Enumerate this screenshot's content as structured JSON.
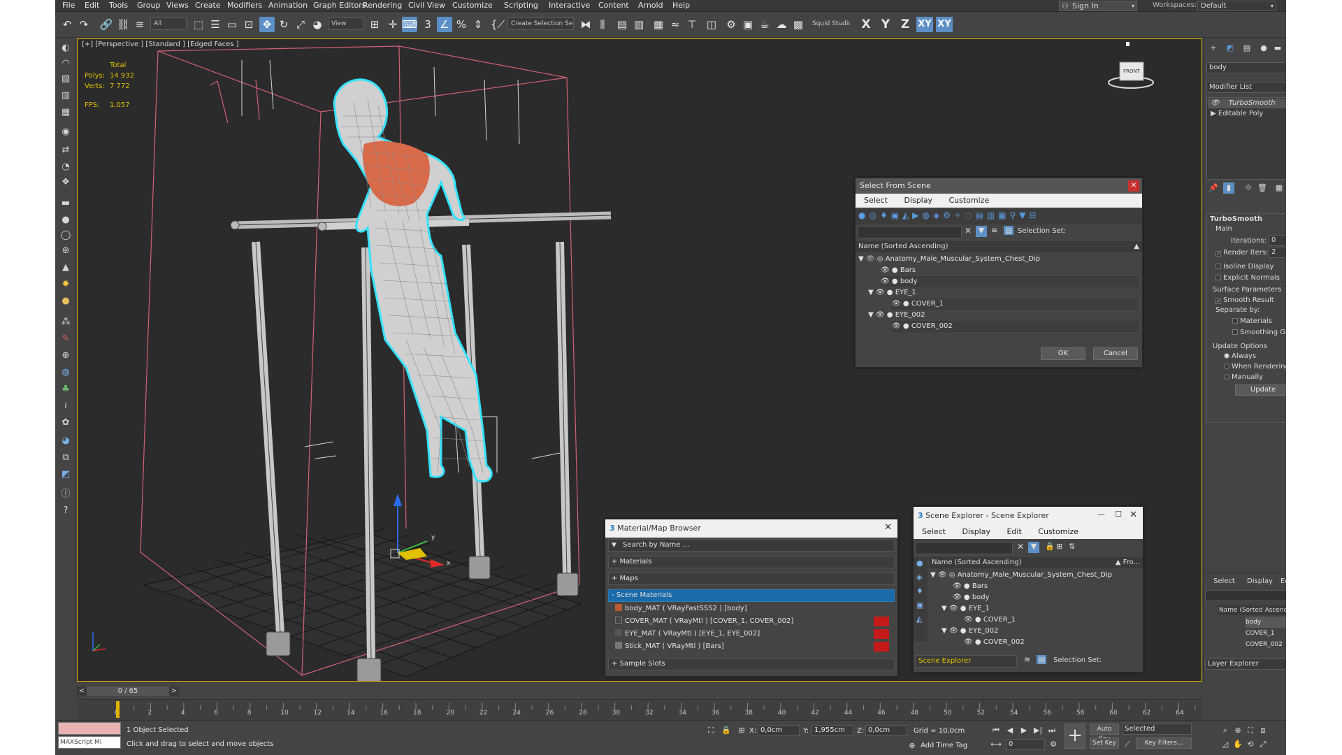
{
  "menubar": {
    "items": [
      "File",
      "Edit",
      "Tools",
      "Group",
      "Views",
      "Create",
      "Modifiers",
      "Animation",
      "Graph Editors",
      "Rendering",
      "Civil View",
      "Customize",
      "Scripting",
      "Interactive",
      "Content",
      "Arnold",
      "Help"
    ],
    "signin": "Sign In",
    "workspaces_label": "Workspaces:",
    "workspace_value": "Default"
  },
  "toolbar": {
    "filter_value": "All",
    "refcoord_value": "View",
    "selection_set_value": "Create Selection Se",
    "workspace_name": "Squid Studio v",
    "axis_x": "X",
    "axis_y": "Y",
    "axis_z": "Z",
    "axis_xy": "XY",
    "axis_xy2": "XY"
  },
  "viewport": {
    "label": "[+] [Perspective ] [Standard ] [Edged Faces ]",
    "stats_header": "Total",
    "polys_label": "Polys:",
    "polys_value": "14 932",
    "verts_label": "Verts:",
    "verts_value": "7 772",
    "fps_label": "FPS:",
    "fps_value": "1,057",
    "viewcube_label": "FRONT",
    "gizmo_y": "y",
    "gizmo_x": "x"
  },
  "select_from_scene": {
    "title": "Select From Scene",
    "menu": [
      "Select",
      "Display",
      "Customize"
    ],
    "selection_set_label": "Selection Set:",
    "column_header": "Name (Sorted Ascending)",
    "rows": [
      {
        "name": "Anatomy_Male_Muscular_System_Chest_Dip",
        "depth": 0,
        "expanded": true
      },
      {
        "name": "Bars",
        "depth": 1
      },
      {
        "name": "body",
        "depth": 1
      },
      {
        "name": "EYE_1",
        "depth": 1,
        "expanded": true
      },
      {
        "name": "COVER_1",
        "depth": 2
      },
      {
        "name": "EYE_002",
        "depth": 1,
        "expanded": true
      },
      {
        "name": "COVER_002",
        "depth": 2
      }
    ],
    "ok_label": "OK",
    "cancel_label": "Cancel"
  },
  "material_browser": {
    "title": "Material/Map Browser",
    "search_placeholder": "Search by Name ...",
    "sections": [
      "+ Materials",
      "+ Maps",
      "- Scene Materials"
    ],
    "materials": [
      "body_MAT ( VRayFastSSS2 ) [body]",
      "COVER_MAT ( VRayMtl ) [COVER_1, COVER_002]",
      "EYE_MAT ( VRayMtl ) [EYE_1, EYE_002]",
      "Stick_MAT ( VRayMtl ) [Bars]"
    ],
    "sample_slots": "+ Sample Slots"
  },
  "scene_explorer": {
    "title": "Scene Explorer - Scene Explorer",
    "menu": [
      "Select",
      "Display",
      "Edit",
      "Customize"
    ],
    "column_header": "Name (Sorted Ascending)",
    "column_header2": "▲ Fro...",
    "rows": [
      {
        "name": "Anatomy_Male_Muscular_System_Chest_Dip",
        "depth": 0
      },
      {
        "name": "Bars",
        "depth": 1
      },
      {
        "name": "body",
        "depth": 1
      },
      {
        "name": "EYE_1",
        "depth": 1
      },
      {
        "name": "COVER_1",
        "depth": 2
      },
      {
        "name": "EYE_002",
        "depth": 1
      },
      {
        "name": "COVER_002",
        "depth": 2
      }
    ],
    "footer_name": "Scene Explorer",
    "selection_set_label": "Selection Set:"
  },
  "command_panel": {
    "name_value": "body",
    "modifier_list": "Modifier List",
    "stack": [
      "TurboSmooth",
      "Editable Poly"
    ],
    "rollout_title": "TurboSmooth",
    "main_label": "Main",
    "iterations_label": "Iterations:",
    "iterations_value": "0",
    "render_iters_label": "Render Iters:",
    "render_iters_value": "2",
    "isoline": "Isoline Display",
    "explicit_normals": "Explicit Normals",
    "surface_params": "Surface Parameters",
    "smooth_result": "Smooth Result",
    "separate_by": "Separate by:",
    "materials": "Materials",
    "smoothing_groups": "Smoothing Groups",
    "update_options": "Update Options",
    "always": "Always",
    "when_rendering": "When Rendering",
    "manually": "Manually",
    "update_btn": "Update"
  },
  "layer_explorer": {
    "menu": [
      "Select",
      "Display",
      "Edit"
    ],
    "column_header": "Name (Sorted Ascending)",
    "rows": [
      "body",
      "COVER_1",
      "COVER_002"
    ],
    "footer": "Layer Explorer"
  },
  "timeline": {
    "frame_display": "0 / 65",
    "ticks": [
      "0",
      "2",
      "4",
      "6",
      "8",
      "10",
      "12",
      "14",
      "16",
      "18",
      "20",
      "22",
      "24",
      "26",
      "28",
      "30",
      "32",
      "34",
      "36",
      "38",
      "40",
      "42",
      "44",
      "46",
      "48",
      "50",
      "52",
      "54",
      "56",
      "58",
      "60",
      "62",
      "64"
    ],
    "current_frame": 0,
    "total_frames": 65
  },
  "statusbar": {
    "maxscript": "MAXScript Mi",
    "selected_text": "1 Object Selected",
    "prompt_text": "Click and drag to select and move objects",
    "x_label": "X:",
    "x_value": "0,0cm",
    "y_label": "Y:",
    "y_value": "1,955cm",
    "z_label": "Z:",
    "z_value": "0,0cm",
    "grid_text": "Grid = 10,0cm",
    "add_time_tag": "Add Time Tag",
    "auto_key": "Auto Key",
    "set_key": "Set Key",
    "selected_dropdown": "Selected",
    "frame_value": "0",
    "key_filters": "Key Filters..."
  },
  "colors": {
    "viewport_bg": "#2b2b2b",
    "selection_yellow": "#e1b300",
    "accent_blue": "#5b8fc5",
    "wire_white": "#d8d8d8",
    "highlight_cyan": "#33e3ff",
    "box_pink": "#d4607a",
    "muscle_orange": "#d86a4a"
  }
}
